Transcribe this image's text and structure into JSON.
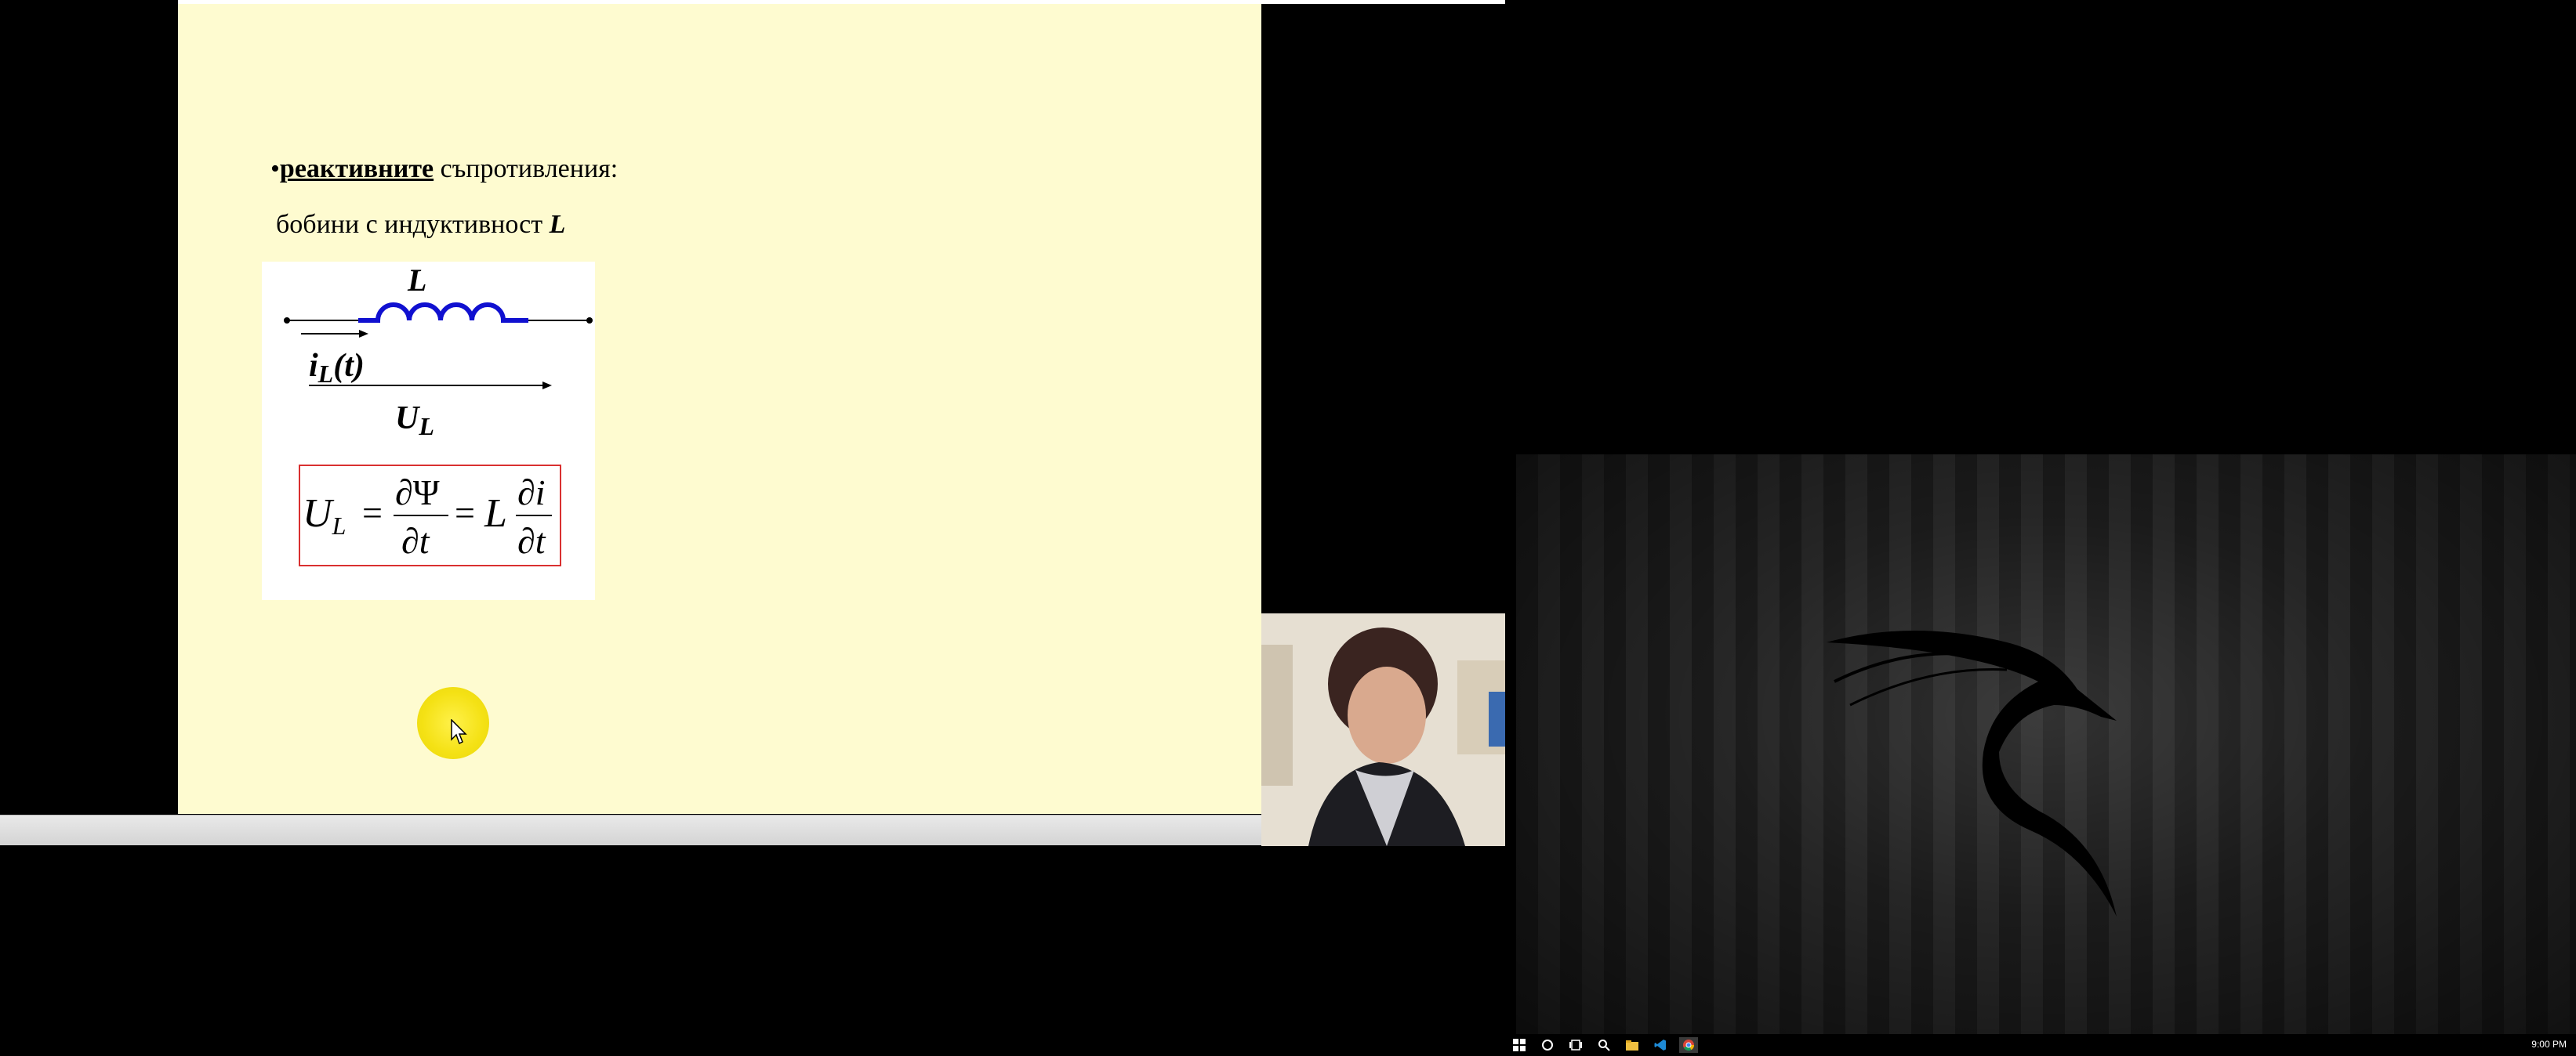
{
  "slide": {
    "bullet_char": "•",
    "bullet_keyword": "реактивните",
    "bullet_rest": " съпротивления:",
    "subtitle_text": "бобини с индуктивност ",
    "subtitle_symbol": "L"
  },
  "diagram": {
    "inductor_label": "L",
    "current_label_main": "i",
    "current_label_sub": "L",
    "current_label_arg": "(t)",
    "voltage_label_main": "U",
    "voltage_label_sub": "L",
    "formula": {
      "lhs_main": "U",
      "lhs_sub": "L",
      "eq1": "=",
      "frac1_num": "∂Ψ",
      "frac1_den": "∂t",
      "eq2": "=",
      "coef": "L",
      "frac2_num": "∂i",
      "frac2_den": "∂t"
    }
  },
  "colors": {
    "slide_bg": "#fefbd0",
    "coil": "#1010d0",
    "formula_border": "#d93030",
    "cursor_highlight": "#f4e114"
  },
  "icons": {
    "cursor": "mouse-pointer-icon",
    "logo": "dragon-logo-icon"
  },
  "taskbar": {
    "icons": [
      "windows-start-icon",
      "cortana-circle-icon",
      "task-view-icon",
      "search-icon",
      "file-explorer-icon",
      "vscode-icon",
      "chrome-icon"
    ],
    "clock": "9:00 PM"
  }
}
